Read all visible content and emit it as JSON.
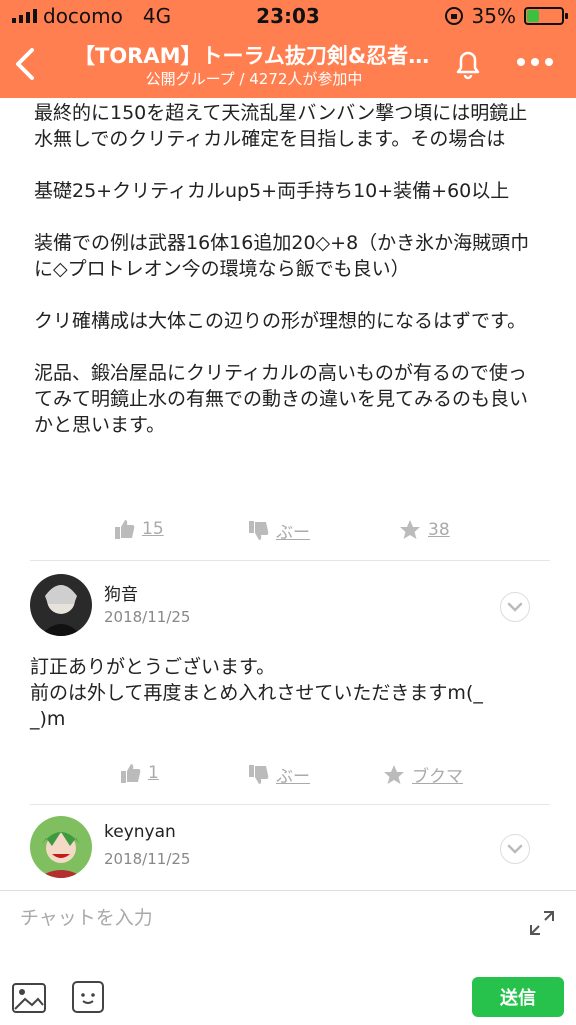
{
  "status": {
    "carrier": "docomo",
    "network": "4G",
    "time": "23:03",
    "battery": "35%",
    "battery_level": 0.35
  },
  "header": {
    "title": "【TORAM】トーラム抜刀剣&忍者グ…",
    "subtitle": "公開グループ / 4272人が参加中"
  },
  "post": {
    "paragraphs": [
      "最終的に150を超えて天流乱星バンバン撃つ頃には明鏡止水無しでのクリティカル確定を目指します。その場合は",
      "基礎25+クリティカルup5+両手持ち10+装備+60以上",
      "装備での例は武器16体16追加20◇+8（かき氷か海賊頭巾に◇プロトレオン今の環境なら飯でも良い）",
      "クリ確構成は大体この辺りの形が理想的になるはずです。",
      "泥品、鍛冶屋品にクリティカルの高いものが有るので使ってみて明鏡止水の有無での動きの違いを見てみるのも良いかと思います。"
    ],
    "actions": {
      "like": "15",
      "dislike": "ぶー",
      "fav": "38"
    }
  },
  "comments": [
    {
      "name": "狗音",
      "date": "2018/11/25",
      "text_line1": "訂正ありがとうございます。",
      "text_line2": "前のは外して再度まとめ入れさせていただきますm(_",
      "text_line3": "_)m",
      "actions": {
        "like": "1",
        "dislike": "ぶー",
        "fav": "ブクマ"
      }
    },
    {
      "name": "keynyan",
      "date": "2018/11/25"
    }
  ],
  "input": {
    "placeholder": "チャットを入力",
    "send": "送信"
  },
  "colors": {
    "header": "#ff7f50",
    "send": "#27c24c"
  }
}
